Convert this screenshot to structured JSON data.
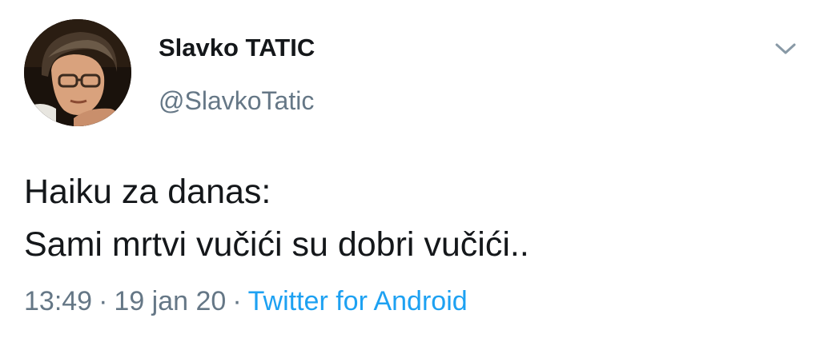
{
  "author": {
    "name": "Slavko TATIC",
    "handle": "@SlavkoTatic",
    "avatar_icon": "profile-photo"
  },
  "tweet": {
    "lines": [
      "Haiku za danas:",
      "Sami mrtvi vučići su dobri vučići.."
    ]
  },
  "meta": {
    "time": "13:49",
    "separator": "·",
    "date": "19 jan 20",
    "source": "Twitter for Android"
  },
  "menu": {
    "icon": "chevron-down-icon"
  },
  "colors": {
    "text": "#14171a",
    "muted": "#657786",
    "link": "#1da1f2",
    "background": "#ffffff"
  }
}
